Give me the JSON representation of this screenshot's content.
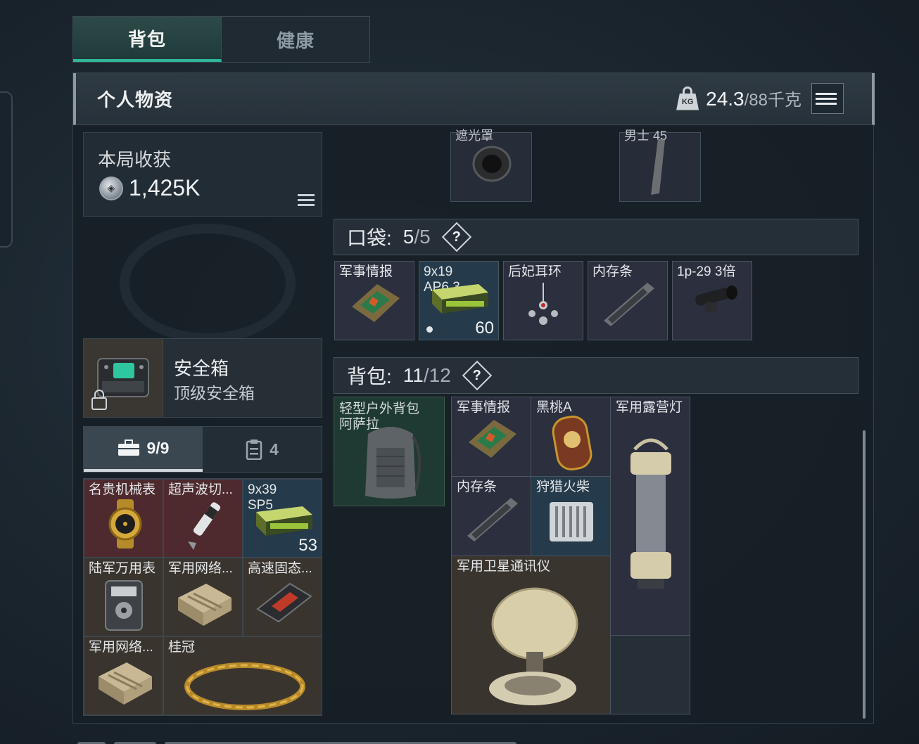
{
  "tabs": [
    {
      "label": "背包",
      "active": true
    },
    {
      "label": "健康",
      "active": false
    }
  ],
  "header": {
    "title": "个人物资",
    "weight_icon_text": "KG",
    "weight_current": "24.3",
    "weight_max": "/88千克"
  },
  "harvest": {
    "label": "本局收获",
    "value": "1,425K"
  },
  "safebox": {
    "title": "安全箱",
    "subtitle": "顶级安全箱"
  },
  "sub_tabs": [
    {
      "label": "9/9",
      "icon": "briefcase-icon",
      "active": true
    },
    {
      "label": "4",
      "icon": "clipboard-icon",
      "active": false
    }
  ],
  "safe_items": [
    {
      "label": "名贵机械表",
      "rarity": "red"
    },
    {
      "label": "超声波切...",
      "rarity": "red"
    },
    {
      "label": "9x39\nSP5",
      "rarity": "blue",
      "count": "53"
    },
    {
      "label": "陆军万用表",
      "rarity": "brown"
    },
    {
      "label": "军用网络...",
      "rarity": "brown"
    },
    {
      "label": "高速固态...",
      "rarity": "brown"
    },
    {
      "label": "军用网络...",
      "rarity": "brown"
    },
    {
      "label": "桂冠",
      "rarity": "brown"
    },
    {
      "label": "",
      "rarity": "brown"
    }
  ],
  "top_partial": [
    {
      "label": "遮光罩"
    },
    {
      "label": "男士 45"
    }
  ],
  "pocket": {
    "label": "口袋:",
    "current": "5",
    "max": "/5",
    "help": "?",
    "items": [
      {
        "label": "军事情报"
      },
      {
        "label": "9x19\nAP6.3",
        "count": "60"
      },
      {
        "label": "后妃耳环"
      },
      {
        "label": "内存条"
      },
      {
        "label": "1p-29 3倍"
      }
    ]
  },
  "backpack": {
    "label": "背包:",
    "current": "11",
    "max": "/12",
    "help": "?",
    "bag_item": "轻型户外背包\n阿萨拉",
    "items": [
      {
        "label": "军事情报"
      },
      {
        "label": "黑桃A"
      },
      {
        "label": "军用露营灯"
      },
      {
        "label": "内存条"
      },
      {
        "label": "狩猎火柴"
      },
      {
        "label": "军用卫星通讯仪"
      }
    ]
  },
  "colors": {
    "accent": "#2fb79a",
    "rarity_red": "#4e2a2e",
    "rarity_brown": "#3a342e",
    "rarity_blue": "#253a4a",
    "rarity_purple": "#2d2f40"
  }
}
